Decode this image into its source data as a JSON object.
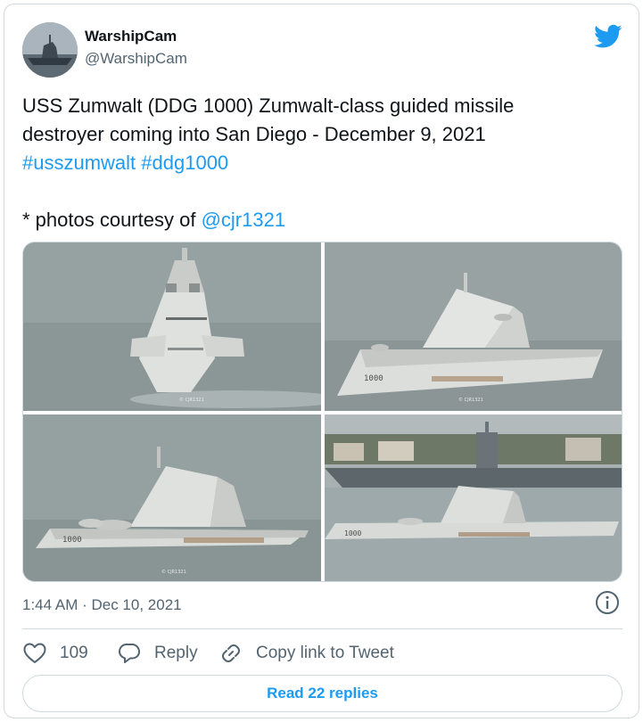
{
  "author": {
    "display_name": "WarshipCam",
    "handle": "@WarshipCam",
    "avatar_icon": "warship-avatar",
    "platform_icon": "twitter-bird-icon"
  },
  "tweet": {
    "line1": "USS Zumwalt (DDG 1000) Zumwalt-class guided missile",
    "line2": "destroyer coming into San Diego - December 9, 2021",
    "hashtag1": "#usszumwalt",
    "hashtag2": "#ddg1000",
    "credit_prefix": "* photos courtesy of ",
    "credit_mention": "@cjr1321"
  },
  "photos": {
    "hull_number": "1000",
    "watermark": "© CJR1321"
  },
  "meta": {
    "timestamp": "1:44 AM · Dec 10, 2021"
  },
  "actions": {
    "like_count": "109",
    "reply_label": "Reply",
    "copy_label": "Copy link to Tweet"
  },
  "footer": {
    "read_replies_label": "Read 22 replies"
  },
  "colors": {
    "link": "#1d9bf0",
    "secondary_text": "#536471",
    "border": "#cfd9de"
  }
}
